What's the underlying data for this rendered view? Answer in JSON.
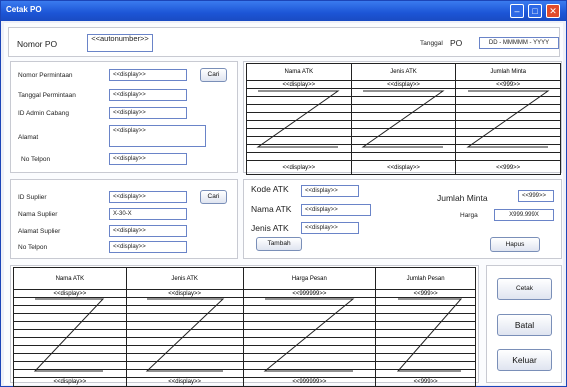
{
  "window": {
    "title": "Cetak PO"
  },
  "header": {
    "nomor_po_label": "Nomor PO",
    "nomor_po_value": "<<autonumber>>",
    "tanggal_label": "Tanggal",
    "tanggal_po_label": "PO",
    "tanggal_value": "DD - MMMMM - YYYY"
  },
  "permintaan": {
    "fields": [
      {
        "label": "Nomor Permintaan",
        "value": "<<display>>"
      },
      {
        "label": "Tanggal Permintaan",
        "value": "<<display>>"
      },
      {
        "label": "ID Admin Cabang",
        "value": "<<display>>"
      },
      {
        "label": "Alamat",
        "value": "<<display>>"
      },
      {
        "label": "No Telpon",
        "value": "<<display>>"
      }
    ],
    "cari_label": "Cari"
  },
  "permintaan_table": {
    "headers": [
      "Nama ATK",
      "Jenis ATK",
      "Jumlah Minta"
    ],
    "first_row": [
      "<<display>>",
      "<<display>>",
      "<<999>>"
    ],
    "last_row": [
      "<<display>>",
      "<<display>>",
      "<<999>>"
    ]
  },
  "supplier": {
    "fields": [
      {
        "label": "ID Suplier",
        "value": "<<display>>"
      },
      {
        "label": "Nama Suplier",
        "value": "X-30-X"
      },
      {
        "label": "Alamat Suplier",
        "value": "<<display>>"
      },
      {
        "label": "No Telpon",
        "value": "<<display>>"
      }
    ],
    "cari_label": "Cari"
  },
  "atk": {
    "kode_label": "Kode ATK",
    "kode_value": "<<display>>",
    "nama_label": "Nama ATK",
    "nama_value": "<<display>>",
    "jenis_label": "Jenis ATK",
    "jenis_value": "<<display>>",
    "jumlah_label": "Jumlah Minta",
    "jumlah_value": "<<999>>",
    "harga_label": "Harga",
    "harga_value": "X999.999X",
    "tambah_label": "Tambah",
    "hapus_label": "Hapus"
  },
  "pesan_table": {
    "headers": [
      "Nama ATK",
      "Jenis ATK",
      "Harga Pesan",
      "Jumlah Pesan"
    ],
    "first_row": [
      "<<display>>",
      "<<display>>",
      "<<999999>>",
      "<<999>>"
    ],
    "last_row": [
      "<<display>>",
      "<<display>>",
      "<<999999>>",
      "<<999>>"
    ]
  },
  "actions": {
    "cetak": "Cetak",
    "batal": "Batal",
    "keluar": "Keluar"
  }
}
